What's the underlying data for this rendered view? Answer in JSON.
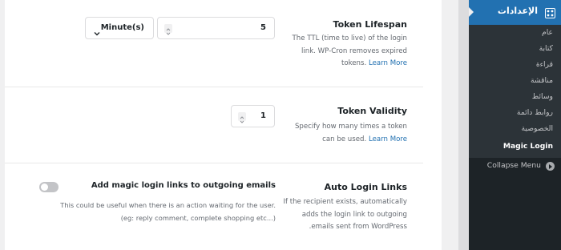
{
  "settings": {
    "token_lifespan": {
      "title": "Token Lifespan",
      "desc": "The TTL (time to live) of the login link. WP-Cron removes expired tokens.",
      "desc_line1": "The TTL (time to live) of the login",
      "desc_line2": "link. WP-Cron removes expired",
      "desc_line3": "tokens.",
      "link": "Learn More",
      "value": "5",
      "unit": "Minute(s)"
    },
    "token_validity": {
      "title": "Token Validity",
      "desc_line1": "Specify how many times a token",
      "desc_line2": "can be used.",
      "link": "Learn More",
      "value": "1"
    },
    "auto_login": {
      "title": "Auto Login Links",
      "desc_line1": "If the recipient exists, automatically",
      "desc_line2": "adds the login link to outgoing",
      "desc_line3": "emails sent from WordPress.",
      "option_title": "Add magic login links to outgoing emails",
      "option_desc_line1": "This could be useful when there is an action waiting for the user.",
      "option_desc_line2": "(eg: reply comment, complete shopping etc...)",
      "enabled": false
    }
  },
  "sidebar": {
    "header": "الإعدادات",
    "items": [
      {
        "label": "عام"
      },
      {
        "label": "كتابة"
      },
      {
        "label": "قراءة"
      },
      {
        "label": "مناقشة"
      },
      {
        "label": "وسائط"
      },
      {
        "label": "روابط دائمة"
      },
      {
        "label": "الخصوصية"
      },
      {
        "label": "Magic Login"
      }
    ],
    "collapse": "Collapse Menu"
  },
  "colors": {
    "accent": "#2271b1",
    "sidebar_bg": "#1d2327",
    "submenu_bg": "#2c3338",
    "link": "#2271b1"
  }
}
